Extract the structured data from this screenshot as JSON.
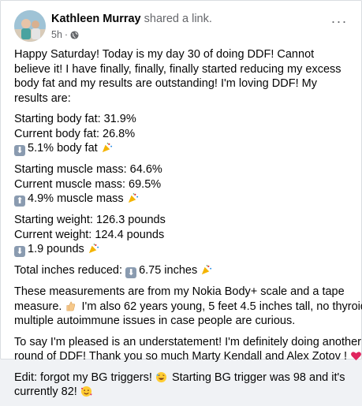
{
  "post": {
    "author_name": "Kathleen Murray",
    "action": "shared a link.",
    "time": "5h",
    "more_label": "···",
    "paragraphs": {
      "intro": "Happy Saturday! Today is my day 30 of doing DDF! Cannot believe it! I have finally, finally, finally started reducing my excess body fat and my results are outstanding! I'm loving DDF! My results are:",
      "body_fat": {
        "start": "Starting body fat: 31.9%",
        "current": "Current body fat: 26.8%",
        "change": "5.1% body fat"
      },
      "muscle": {
        "start": "Starting muscle mass: 64.6%",
        "current": "Current muscle mass: 69.5%",
        "change": "4.9% muscle mass"
      },
      "weight": {
        "start": "Starting weight: 126.3 pounds",
        "current": "Current weight: 124.4 pounds",
        "change": "1.9 pounds"
      },
      "inches": {
        "prefix": "Total inches reduced:",
        "value": "6.75 inches"
      },
      "measure_a": "These measurements are from my Nokia Body+ scale and a tape",
      "measure_b": "measure.",
      "measure_c": "I'm also 62 years young, 5 feet 4.5 inches tall, no thyroid,",
      "measure_d": "multiple autoimmune issues in case people are curious.",
      "pleased_a": "To say I'm pleased is an understatement! I'm definitely doing another",
      "pleased_b": "round of DDF! Thank you so much Marty Kendall and Alex Zotov !",
      "edit_a": "Edit: forgot my BG triggers!",
      "edit_b": "Starting BG trigger was 98 and it's",
      "edit_c": "currently 82!"
    }
  },
  "icons": {
    "down_arrow": "⬇",
    "up_arrow": "⬆"
  },
  "colors": {
    "text": "#050505",
    "secondary": "#65676b",
    "heart": "#e0245e"
  }
}
